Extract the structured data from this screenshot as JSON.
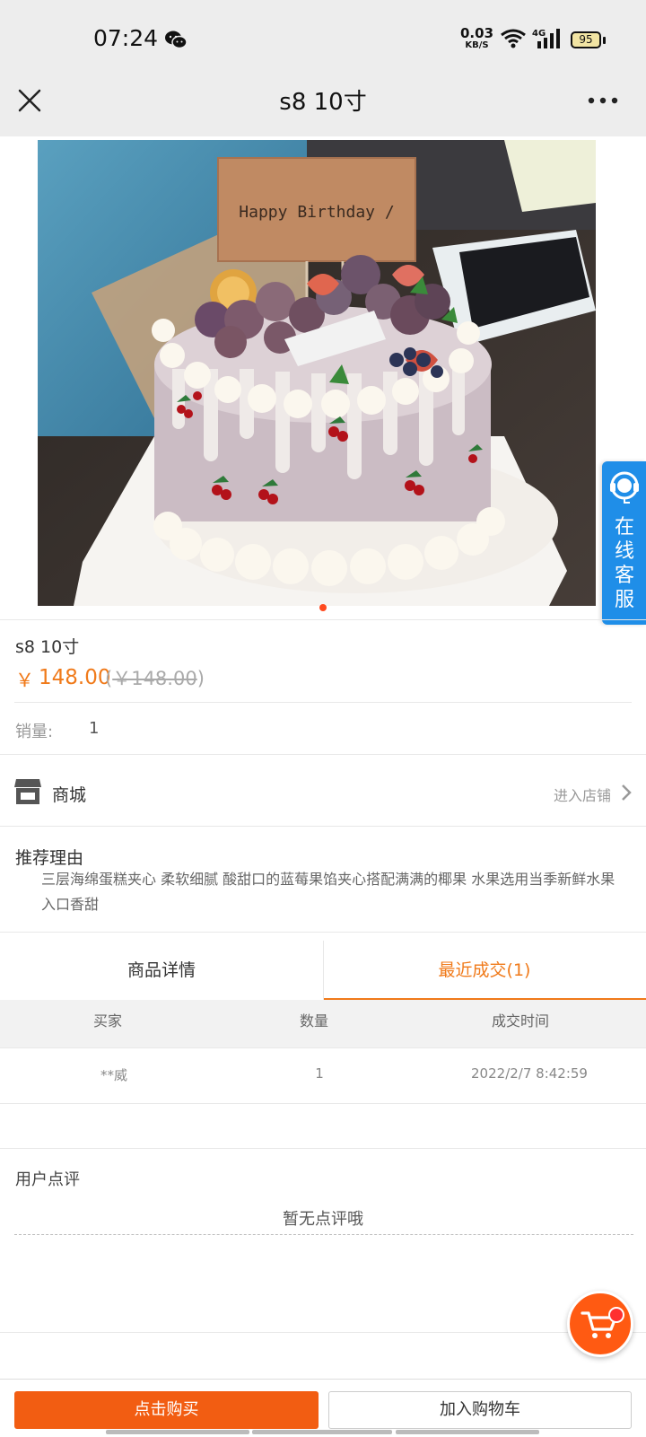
{
  "status_bar": {
    "time": "07:24",
    "net_speed_value": "0.03",
    "net_speed_unit": "KB/S",
    "network_type": "4G",
    "battery": "95",
    "icons": [
      "wechat-icon",
      "wifi-icon",
      "cellular-signal-icon",
      "battery-icon"
    ]
  },
  "nav": {
    "title": "s8 10寸",
    "close_icon": "close-icon",
    "more_icon": "more-icon"
  },
  "product": {
    "image_label": "Happy Birthday /",
    "name": "s8 10寸",
    "price_symbol": "￥",
    "price": "148.00",
    "original_price_open": "(",
    "original_price": "￥148.00",
    "original_price_close": ")",
    "sales_label": "销量:",
    "sales_value": "1"
  },
  "customer_service": {
    "label": "在线客服"
  },
  "shop": {
    "name": "商城",
    "enter_label": "进入店铺"
  },
  "recommend": {
    "title": "推荐理由",
    "text": "三层海绵蛋糕夹心 柔软细腻 酸甜口的蓝莓果馅夹心搭配满满的椰果 水果选用当季新鲜水果 入口香甜"
  },
  "tabs": [
    {
      "label": "商品详情",
      "active": false
    },
    {
      "label": "最近成交(1)",
      "active": true
    }
  ],
  "deals": {
    "headers": [
      "买家",
      "数量",
      "成交时间"
    ],
    "rows": [
      {
        "buyer": "**威",
        "quantity": "1",
        "time": "2022/2/7 8:42:59"
      }
    ]
  },
  "reviews": {
    "title": "用户点评",
    "empty_text": "暂无点评哦"
  },
  "actions": {
    "buy_label": "点击购买",
    "add_cart_label": "加入购物车"
  },
  "colors": {
    "accent": "#f07a1a",
    "buy_button": "#f25d12",
    "service_blue": "#1f8ee8"
  }
}
